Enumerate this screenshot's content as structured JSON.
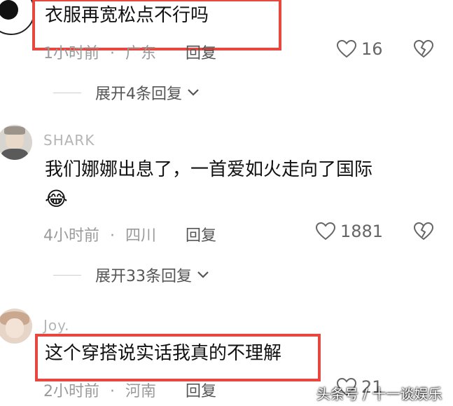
{
  "comments": [
    {
      "text": "衣服再宽松点不行吗",
      "time": "1小时前",
      "location": "广东",
      "reply_label": "回复",
      "likes": "16",
      "expand_label": "展开4条回复"
    },
    {
      "username": "SHARK",
      "text_line1": "我们娜娜出息了，一首爱如火走向了国际",
      "emoji": "😂",
      "time": "4小时前",
      "location": "四川",
      "reply_label": "回复",
      "likes": "1881",
      "expand_label": "展开33条回复"
    },
    {
      "username": "Joy.",
      "text": "这个穿搭说实话我真的不理解",
      "time": "2小时前",
      "location": "河南",
      "reply_label": "回复",
      "likes": "21"
    }
  ],
  "separator": "·",
  "watermark": "头条号 / 十一谈娱乐",
  "colors": {
    "highlight_box": "#e8473f",
    "meta_text": "#9a9a9a"
  }
}
